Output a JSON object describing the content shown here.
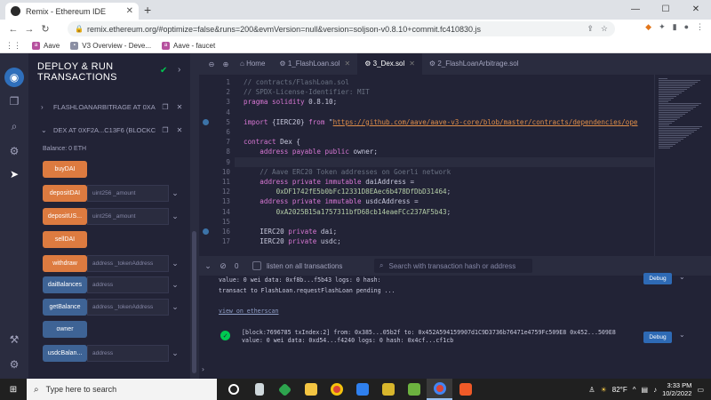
{
  "browser": {
    "tab_title": "Remix - Ethereum IDE",
    "url": "remix.ethereum.org/#optimize=false&runs=200&evmVersion=null&version=soljson-v0.8.10+commit.fc410830.js",
    "bookmarks": [
      "Aave",
      "V3 Overview - Deve...",
      "Aave - faucet"
    ]
  },
  "panel": {
    "title_line1": "DEPLOY & RUN",
    "title_line2": "TRANSACTIONS",
    "contracts": [
      {
        "name": "FLASHLOANARBITRAGE AT 0XA"
      },
      {
        "name": "DEX AT 0XF2A...C13F6 (BLOCKC"
      }
    ],
    "balance": "Balance: 0 ETH",
    "functions": [
      {
        "label": "buyDAI",
        "placeholder": ""
      },
      {
        "label": "depositDAI",
        "placeholder": "uint256 _amount"
      },
      {
        "label": "depositUS...",
        "placeholder": "uint256 _amount"
      },
      {
        "label": "sellDAI",
        "placeholder": ""
      },
      {
        "label": "withdraw",
        "placeholder": "address _tokenAddress"
      },
      {
        "label": "daiBalances",
        "placeholder": "address"
      },
      {
        "label": "getBalance",
        "placeholder": "address _tokenAddress"
      },
      {
        "label": "owner",
        "placeholder": ""
      },
      {
        "label": "usdcBalan...",
        "placeholder": "address"
      }
    ]
  },
  "editor": {
    "tabs": [
      "Home",
      "1_FlashLoan.sol",
      "3_Dex.sol",
      "2_FlashLoanArbitrage.sol"
    ],
    "active_tab": "3_Dex.sol",
    "line_numbers": [
      "1",
      "2",
      "3",
      "4",
      "5",
      "6",
      "7",
      "8",
      "9",
      "10",
      "11",
      "12",
      "13",
      "14",
      "15",
      "16",
      "17"
    ],
    "lines": [
      "// contracts/FlashLoan.sol",
      "// SPDX-License-Identifier: MIT",
      "pragma solidity 0.8.10;",
      "",
      "import {IERC20} from \"https://github.com/aave/aave-v3-core/blob/master/contracts/dependencies/ope",
      "",
      "contract Dex {",
      "    address payable public owner;",
      "",
      "    // Aave ERC20 Token addresses on Goerli network",
      "    address private immutable daiAddress =",
      "        0xDF1742fE5b0bFc12331D8EAec6b478DfDbD31464;",
      "    address private immutable usdcAddress =",
      "        0xA2025B15a1757311bfD68cb14eaeFCc237AF5b43;",
      "",
      "    IERC20 private dai;",
      "    IERC20 private usdc;"
    ]
  },
  "terminal": {
    "count": "0",
    "listen_label": "listen on all transactions",
    "search_placeholder": "Search with transaction hash or address",
    "log1": "value: 0 wei data: 0xf8b...f5b43 logs: 0 hash:",
    "log2": "transact to FlashLoan.requestFlashLoan pending ...",
    "log3": "view on etherscan",
    "log4": "[block:7696785 txIndex:2] from: 0x385...05b2f to: 0x452A594159907d1C9D3736b76471e4759Fc509E8 0x452...509E8",
    "log5": "value: 0 wei data: 0xd54...f4240 logs: 0 hash: 0x4cf...cf1cb",
    "debug": "Debug"
  },
  "taskbar": {
    "search": "Type here to search",
    "temp": "82°F",
    "time": "3:33 PM",
    "date": "10/2/2022"
  }
}
